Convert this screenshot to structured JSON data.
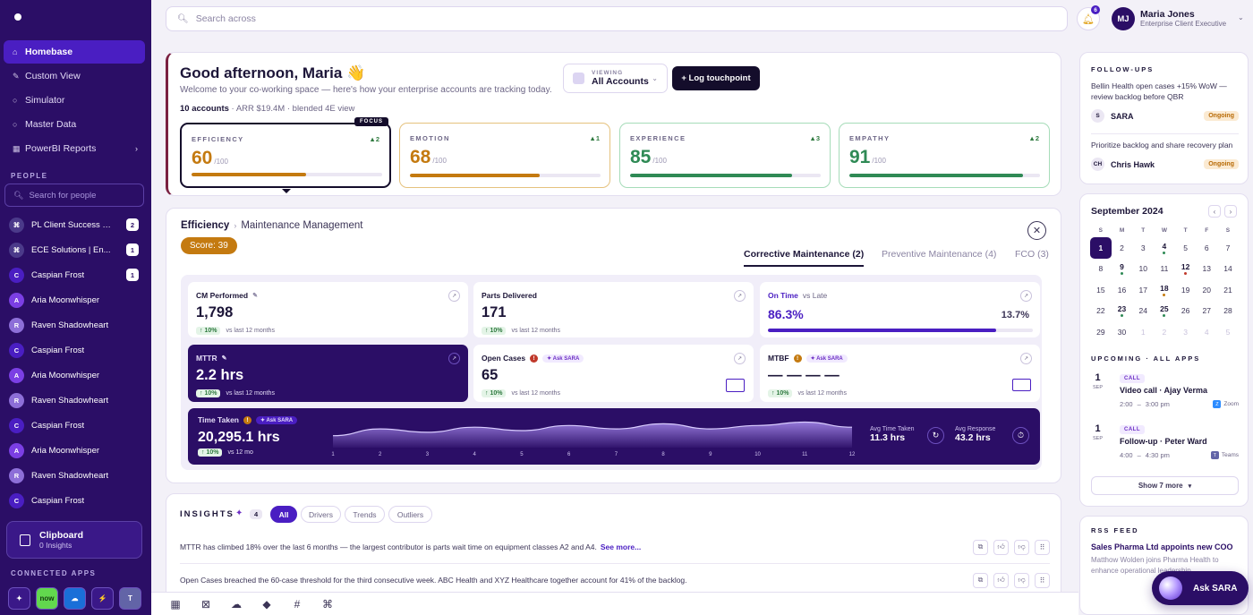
{
  "sidebar": {
    "nav": [
      {
        "label": "Homebase",
        "icon": "home-icon",
        "active": true
      },
      {
        "label": "Custom View",
        "icon": "pencil-icon"
      },
      {
        "label": "Simulator",
        "icon": "circle-icon"
      },
      {
        "label": "Master Data",
        "icon": "circle-icon"
      },
      {
        "label": "PowerBI Reports",
        "icon": "grid-icon",
        "chevron": true
      }
    ],
    "people_label": "PEOPLE",
    "people_search_placeholder": "Search for people",
    "people": [
      {
        "initial": "⌘",
        "name": "PL Client Success So...",
        "count": "2",
        "color": "#4b3a8a"
      },
      {
        "initial": "⌘",
        "name": "ECE Solutions | En...",
        "count": "1",
        "color": "#4b3a8a"
      },
      {
        "initial": "C",
        "name": "Caspian Frost",
        "count": "1",
        "color": "#4a1ec2"
      },
      {
        "initial": "A",
        "name": "Aria Moonwhisper",
        "count": "",
        "color": "#7b3fe4"
      },
      {
        "initial": "R",
        "name": "Raven Shadowheart",
        "count": "",
        "color": "#8d6fd8"
      },
      {
        "initial": "C",
        "name": "Caspian Frost",
        "count": "",
        "color": "#4a1ec2"
      },
      {
        "initial": "A",
        "name": "Aria Moonwhisper",
        "count": "",
        "color": "#7b3fe4"
      },
      {
        "initial": "R",
        "name": "Raven Shadowheart",
        "count": "",
        "color": "#8d6fd8"
      },
      {
        "initial": "C",
        "name": "Caspian Frost",
        "count": "",
        "color": "#4a1ec2"
      },
      {
        "initial": "A",
        "name": "Aria Moonwhisper",
        "count": "",
        "color": "#7b3fe4"
      },
      {
        "initial": "R",
        "name": "Raven Shadowheart",
        "count": "",
        "color": "#8d6fd8"
      },
      {
        "initial": "C",
        "name": "Caspian Frost",
        "count": "",
        "color": "#4a1ec2"
      }
    ],
    "clipboard": {
      "title": "Clipboard",
      "subtitle": "0 Insights"
    },
    "connected_label": "CONNECTED APPS",
    "apps": [
      {
        "label": "✦",
        "bg": "#3a1888"
      },
      {
        "label": "now",
        "bg": "#62d84e"
      },
      {
        "label": "☁",
        "bg": "#1a6fd8"
      },
      {
        "label": "⚡",
        "bg": "#3a1888"
      },
      {
        "label": "T",
        "bg": "#6264a7"
      }
    ]
  },
  "topbar": {
    "search_placeholder": "Search across",
    "notifications": "6",
    "user": {
      "initials": "MJ",
      "name": "Maria Jones",
      "role": "Enterprise Client Executive"
    }
  },
  "hero": {
    "greeting": "Good afternoon, Maria 👋",
    "welcome": "Welcome to your co-working space — here's how your enterprise accounts are tracking today.",
    "accounts": "10 accounts",
    "summary_rest": " · ARR $19.4M · blended 4E view",
    "viewing_label": "VIEWING",
    "viewing_value": "All Accounts",
    "log_button": "+ Log touchpoint",
    "focus_label": "FOCUS",
    "metrics": [
      {
        "label": "EFFICIENCY",
        "delta": "▲2",
        "value": "60",
        "of": "/100",
        "pct": 60,
        "color": "#c47a10",
        "border": "#140d2b"
      },
      {
        "label": "EMOTION",
        "delta": "▲1",
        "value": "68",
        "of": "/100",
        "pct": 68,
        "color": "#c47a10",
        "border": "#e5c27e"
      },
      {
        "label": "EXPERIENCE",
        "delta": "▲3",
        "value": "85",
        "of": "/100",
        "pct": 85,
        "color": "#2f8a55",
        "border": "#a6dcb9"
      },
      {
        "label": "EMPATHY",
        "delta": "▲2",
        "value": "91",
        "of": "/100",
        "pct": 91,
        "color": "#2f8a55",
        "border": "#a6dcb9"
      }
    ]
  },
  "detail": {
    "crumb_main": "Efficiency",
    "crumb_sub": "Maintenance Management",
    "score": "Score: 39",
    "tabs": [
      "Corrective Maintenance (2)",
      "Preventive Maintenance (4)",
      "FCO (3)"
    ],
    "tiles": {
      "cm": {
        "label": "CM Performed",
        "value": "1,798",
        "change": "10%",
        "vs": "vs last 12 months"
      },
      "parts": {
        "label": "Parts Delivered",
        "value": "171",
        "change": "10%",
        "vs": "vs last 12 months"
      },
      "ontime": {
        "label": "On Time",
        "sub": "vs Late",
        "value": "86.3%",
        "late": "13.7%",
        "pct": 86.3
      },
      "mttr": {
        "label": "MTTR",
        "value": "2.2 hrs",
        "change": "10%",
        "vs": "vs last 12 months"
      },
      "open": {
        "label": "Open Cases",
        "ask": "Ask SARA",
        "value": "65",
        "change": "10%",
        "vs": "vs last 12 months"
      },
      "mtbf": {
        "label": "MTBF",
        "ask": "Ask SARA",
        "value": "— — — —",
        "change": "10%",
        "vs": "vs last 12 months"
      },
      "time": {
        "label": "Time Taken",
        "ask": "Ask SARA",
        "value": "20,295.1 hrs",
        "change": "10%",
        "vs": "vs 12 mo",
        "avg_time_label": "Avg Time Taken",
        "avg_time": "11.3 hrs",
        "avg_resp_label": "Avg Response",
        "avg_resp": "43.2 hrs"
      }
    }
  },
  "chart_data": {
    "type": "area",
    "x": [
      "1",
      "2",
      "3",
      "4",
      "5",
      "6",
      "7",
      "8",
      "9",
      "10",
      "11",
      "12"
    ],
    "values": [
      0.35,
      0.55,
      0.45,
      0.6,
      0.5,
      0.65,
      0.55,
      0.7,
      0.55,
      0.65,
      0.75,
      0.6
    ]
  },
  "insights": {
    "title": "INSIGHTS",
    "count": "4",
    "filters": [
      "All",
      "Drivers",
      "Trends",
      "Outliers"
    ],
    "rows": [
      {
        "text": "MTTR has climbed 18% over the last 6 months — the largest contributor is parts wait time on equipment classes A2 and A4.",
        "more": "See more..."
      },
      {
        "text": "Open Cases breached the 60-case threshold for the third consecutive week. ABC Health and XYZ Healthcare together account for 41% of the backlog.",
        "more": ""
      }
    ]
  },
  "followups": {
    "title": "FOLLOW-UPS",
    "items": [
      {
        "text": "Bellin Health open cases +15% WoW — review backlog before QBR",
        "initials": "S",
        "owner": "SARA",
        "status": "Ongoing"
      },
      {
        "text": "Prioritize backlog and share recovery plan",
        "initials": "CH",
        "owner": "Chris Hawk",
        "status": "Ongoing"
      }
    ]
  },
  "calendar": {
    "title": "September 2024",
    "weekdays": [
      "S",
      "M",
      "T",
      "W",
      "T",
      "F",
      "S"
    ],
    "weeks": [
      [
        {
          "d": "1",
          "s": "sel"
        },
        {
          "d": "2"
        },
        {
          "d": "3"
        },
        {
          "d": "4",
          "s": "b",
          "dot": "#2f8a55"
        },
        {
          "d": "5"
        },
        {
          "d": "6"
        },
        {
          "d": "7"
        }
      ],
      [
        {
          "d": "8"
        },
        {
          "d": "9",
          "s": "b",
          "dot": "#2f8a55"
        },
        {
          "d": "10"
        },
        {
          "d": "11"
        },
        {
          "d": "12",
          "s": "b",
          "dot": "#c0392b"
        },
        {
          "d": "13"
        },
        {
          "d": "14"
        }
      ],
      [
        {
          "d": "15"
        },
        {
          "d": "16"
        },
        {
          "d": "17"
        },
        {
          "d": "18",
          "s": "b",
          "dot": "#c47a10"
        },
        {
          "d": "19"
        },
        {
          "d": "20"
        },
        {
          "d": "21"
        }
      ],
      [
        {
          "d": "22"
        },
        {
          "d": "23",
          "s": "b",
          "dot": "#2f8a55"
        },
        {
          "d": "24"
        },
        {
          "d": "25",
          "s": "b",
          "dot": "#2f8a55"
        },
        {
          "d": "26"
        },
        {
          "d": "27"
        },
        {
          "d": "28"
        }
      ],
      [
        {
          "d": "29"
        },
        {
          "d": "30"
        },
        {
          "d": "1",
          "s": "mt"
        },
        {
          "d": "2",
          "s": "mt"
        },
        {
          "d": "3",
          "s": "mt"
        },
        {
          "d": "4",
          "s": "mt"
        },
        {
          "d": "5",
          "s": "mt"
        }
      ]
    ],
    "upcoming_label": "UPCOMING · ALL APPS",
    "events": [
      {
        "day": "1",
        "mon": "SEP",
        "tag": "CALL",
        "title": "Video call · Ajay Verma",
        "start": "2:00",
        "end": "3:00 pm",
        "app": "Zoom",
        "app_icon": "Z",
        "app_color": "#2d8cff"
      },
      {
        "day": "1",
        "mon": "SEP",
        "tag": "CALL",
        "title": "Follow-up · Peter Ward",
        "start": "4:00",
        "end": "4:30 pm",
        "app": "Teams",
        "app_icon": "T",
        "app_color": "#6264a7"
      }
    ],
    "show_more": "Show 7 more"
  },
  "rss": {
    "title": "RSS FEED",
    "headline": "Sales Pharma Ltd appoints new COO",
    "body": "Matthow Wolden joins Pharma Health to enhance operational leadership"
  },
  "ask_sara": "Ask SARA"
}
